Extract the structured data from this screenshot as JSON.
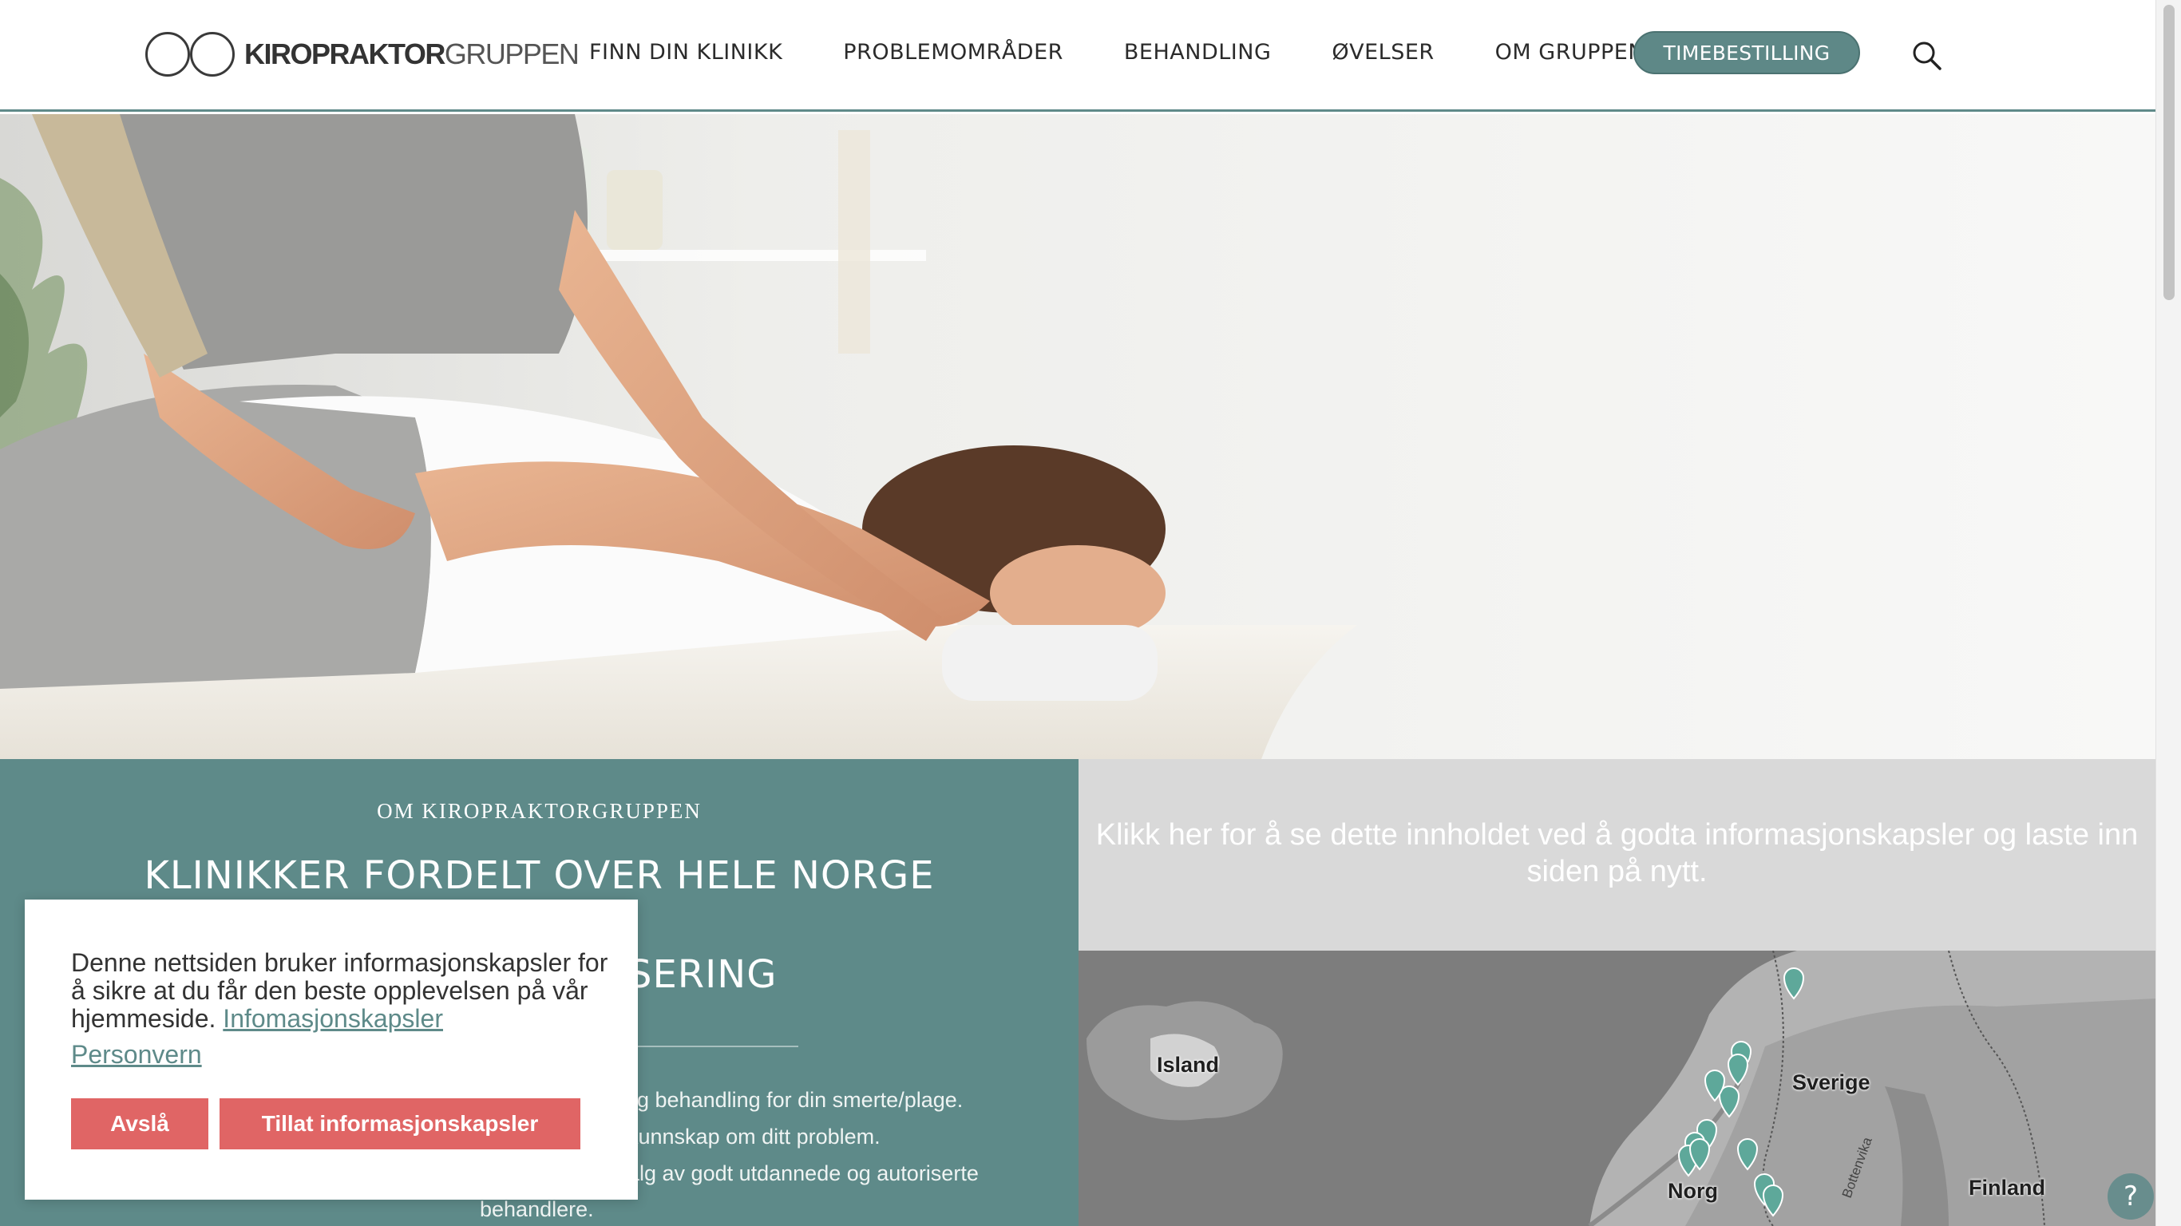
{
  "header": {
    "logo": {
      "bold": "KIROPRAKTOR",
      "light": "GRUPPEN"
    },
    "nav": [
      {
        "label": "FINN DIN KLINIKK"
      },
      {
        "label": "PROBLEMOMRÅDER"
      },
      {
        "label": "BEHANDLING"
      },
      {
        "label": "ØVELSER"
      },
      {
        "label": "OM GRUPPEN"
      }
    ],
    "booking_label": "TIMEBESTILLING",
    "search_icon": "search-icon"
  },
  "about": {
    "eyebrow": "OM KIROPRAKTORGRUPPEN",
    "title": "KLINIKKER FORDELT OVER HELE NORGE",
    "title2": "SERING",
    "lines": [
      "lig behandling for din smerte/plage.",
      "kunnskap om ditt problem.",
      "alg av godt utdannede og autoriserte",
      "behandlere."
    ]
  },
  "map": {
    "notice": "Klikk her for å se dette innholdet ved å godta informasjonskapsler og laste inn siden på nytt.",
    "labels": {
      "island": "Island",
      "sverige": "Sverige",
      "norge": "Norg",
      "finland": "Finland",
      "bottenvika": "Bottenvika"
    },
    "pin_color": "#5ea89a"
  },
  "cookie": {
    "text": "Denne nettsiden bruker informasjonskapsler for å sikre at du får den beste opplevelsen på vår hjemmeside.",
    "link1": "Infomasjonskapsler",
    "link2": "Personvern",
    "decline": "Avslå",
    "accept": "Tillat informasjonskapsler"
  },
  "colors": {
    "accent": "#5e8a89",
    "cookie_button": "#e06565"
  }
}
